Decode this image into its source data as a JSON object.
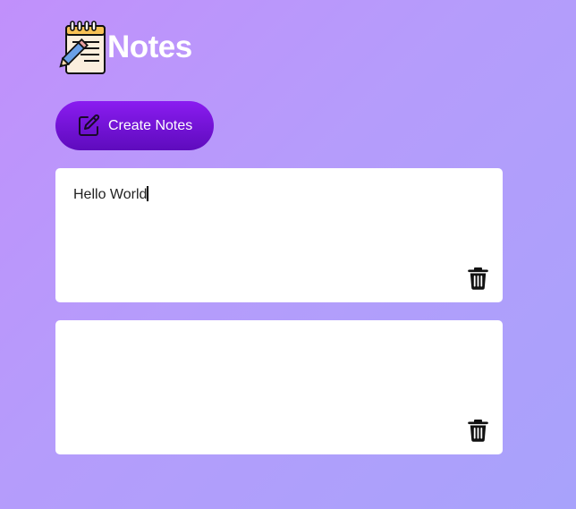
{
  "app": {
    "title": "Notes",
    "logo_icon": "notepad-pencil-icon"
  },
  "toolbar": {
    "create_label": "Create Notes",
    "create_icon": "edit-icon"
  },
  "notes": [
    {
      "text": "Hello World",
      "delete_icon": "trash-icon",
      "focused": true
    },
    {
      "text": "",
      "delete_icon": "trash-icon",
      "focused": false
    }
  ],
  "colors": {
    "background_start": "#c190fb",
    "background_end": "#a8a2fb",
    "button_top": "#8a1cf0",
    "button_bottom": "#5e0bbd",
    "note_bg": "#ffffff"
  }
}
